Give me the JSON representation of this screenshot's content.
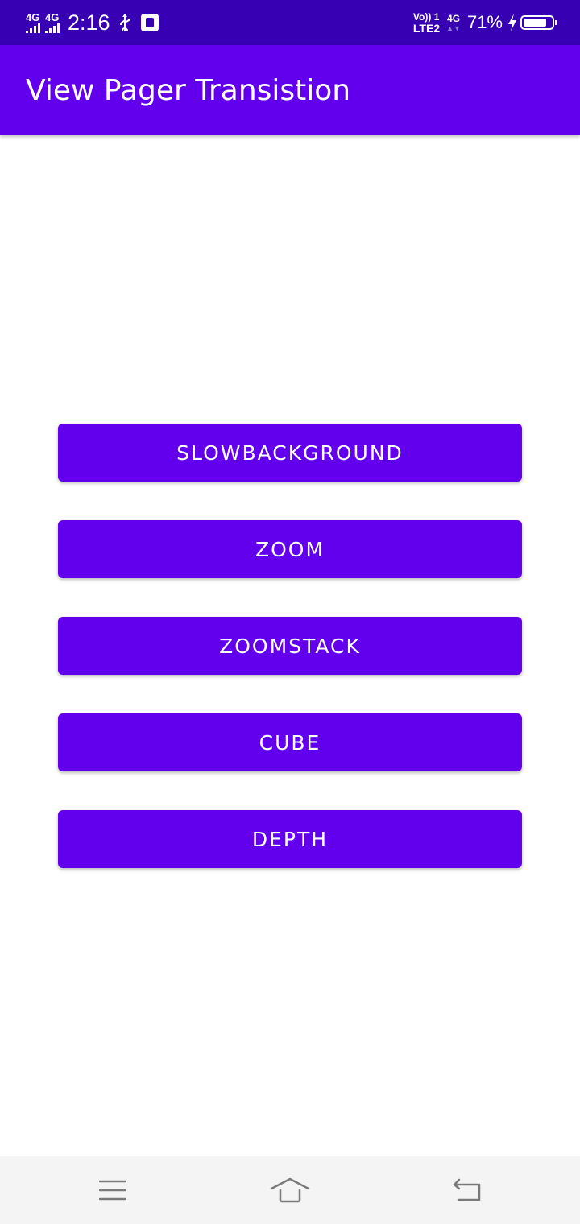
{
  "status_bar": {
    "sim1_network": "4G",
    "sim2_network": "4G",
    "time": "2:16",
    "volte_top": "Vo)) 1",
    "volte_bottom": "LTE2",
    "data_network": "4G",
    "data_arrows": "▲▼",
    "battery_percent": "71%",
    "icons": [
      "signal-icon",
      "usb-icon",
      "debug-icon",
      "bolt-icon",
      "battery-icon"
    ]
  },
  "app_bar": {
    "title": "View Pager Transistion"
  },
  "buttons": [
    {
      "label": "SLOWBACKGROUND"
    },
    {
      "label": "ZOOM"
    },
    {
      "label": "ZOOMSTACK"
    },
    {
      "label": "CUBE"
    },
    {
      "label": "DEPTH"
    }
  ],
  "nav_bar": {
    "icons": [
      "menu-icon",
      "home-icon",
      "back-icon"
    ]
  },
  "colors": {
    "status_bar": "#3700b3",
    "primary": "#6200ee",
    "nav_bar": "#f4f4f4"
  }
}
